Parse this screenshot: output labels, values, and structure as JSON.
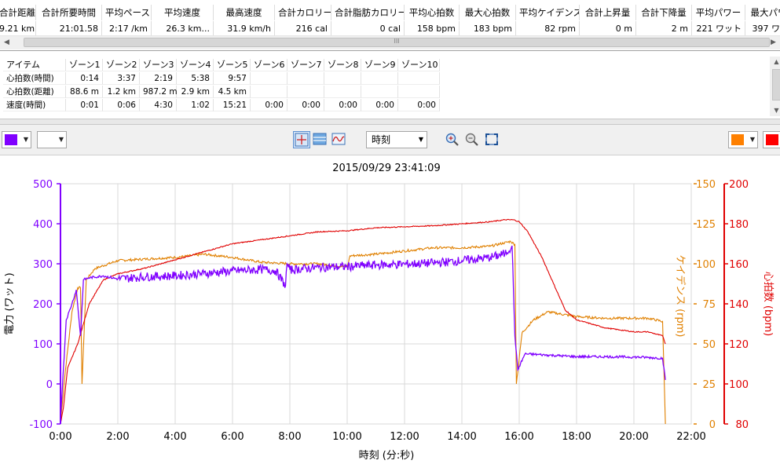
{
  "summary": {
    "headers": [
      "合計距離",
      "合計所要時間",
      "平均ペース",
      "平均速度",
      "最高速度",
      "合計カロリー",
      "合計脂肪カロリー",
      "平均心拍数",
      "最大心拍数",
      "平均ケイデンス",
      "合計上昇量",
      "合計下降量",
      "平均パワー",
      "最大パワ"
    ],
    "values": [
      "9.21 km",
      "21:01.58",
      "2:17 /km",
      "26.3 km...",
      "31.9 km/h",
      "216 cal",
      "0 cal",
      "158 bpm",
      "183 bpm",
      "82 rpm",
      "0 m",
      "2 m",
      "221 ワット",
      "397 ワッ"
    ],
    "scroll_grip": "III"
  },
  "zones": {
    "headers": [
      "アイテム",
      "ゾーン1",
      "ゾーン2",
      "ゾーン3",
      "ゾーン4",
      "ゾーン5",
      "ゾーン6",
      "ゾーン7",
      "ゾーン8",
      "ゾーン9",
      "ゾーン10"
    ],
    "rows": [
      [
        "心拍数(時間)",
        "0:14",
        "3:37",
        "2:19",
        "5:38",
        "9:57",
        "",
        "",
        "",
        "",
        ""
      ],
      [
        "心拍数(距離)",
        "88.6 m",
        "1.2 km",
        "987.2 m",
        "2.9 km",
        "4.5 km",
        "",
        "",
        "",
        "",
        ""
      ],
      [
        "速度(時間)",
        "0:01",
        "0:06",
        "4:30",
        "1:02",
        "15:21",
        "0:00",
        "0:00",
        "0:00",
        "0:00",
        "0:00"
      ]
    ]
  },
  "toolbar": {
    "left_color_1": "#8000ff",
    "left_color_2": "#ffffff",
    "right_color_1": "#ff8000",
    "right_color_2": "#ff0000",
    "axis_select": "時刻",
    "icons": [
      "crosshair-icon",
      "split-view-icon",
      "wave-icon",
      "zoom-in-icon",
      "zoom-out-icon",
      "fit-icon"
    ]
  },
  "chart_data": {
    "type": "line",
    "title": "2015/09/29 23:41:09",
    "xlabel": "時刻 (分:秒)",
    "x_ticks": [
      "0:00",
      "2:00",
      "4:00",
      "6:00",
      "8:00",
      "10:00",
      "12:00",
      "14:00",
      "16:00",
      "18:00",
      "20:00",
      "22:00"
    ],
    "xlim": [
      0,
      22
    ],
    "grid": true,
    "axes": [
      {
        "id": "power",
        "label": "電力 (ワット)",
        "side": "left",
        "color": "#8000ff",
        "ylim": [
          -100,
          500
        ],
        "ticks": [
          -100,
          0,
          100,
          200,
          300,
          400,
          500
        ]
      },
      {
        "id": "cadence",
        "label": "ケイデンス (rpm)",
        "side": "right",
        "color": "#e08000",
        "ylim": [
          0,
          150
        ],
        "ticks": [
          0,
          25,
          50,
          75,
          100,
          125,
          150
        ]
      },
      {
        "id": "hr",
        "label": "心拍数 (bpm)",
        "side": "right",
        "color": "#e00000",
        "ylim": [
          80,
          200
        ],
        "ticks": [
          80,
          100,
          120,
          140,
          160,
          180,
          200
        ]
      }
    ],
    "series": [
      {
        "axis": "power",
        "color": "#8000ff",
        "x": [
          0,
          0.2,
          0.4,
          0.55,
          0.7,
          0.8,
          1.0,
          1.5,
          2,
          3,
          4,
          5,
          6,
          7,
          7.5,
          7.85,
          7.9,
          8,
          9,
          10,
          11,
          12,
          13,
          14,
          15,
          15.5,
          15.75,
          15.85,
          15.95,
          16.2,
          17,
          18,
          19,
          20,
          20.5,
          21.0,
          21.1
        ],
        "y": [
          -90,
          160,
          200,
          235,
          120,
          260,
          265,
          270,
          262,
          268,
          270,
          276,
          282,
          286,
          283,
          245,
          300,
          285,
          291,
          293,
          297,
          299,
          302,
          308,
          316,
          325,
          345,
          120,
          35,
          75,
          72,
          68,
          68,
          67,
          66,
          64,
          10
        ]
      },
      {
        "axis": "cadence",
        "color": "#e08000",
        "x": [
          0,
          0.15,
          0.4,
          0.6,
          0.7,
          0.75,
          0.9,
          1.2,
          2,
          3,
          4,
          5,
          6,
          7,
          8,
          9,
          10,
          10.1,
          11,
          12,
          13,
          14,
          15,
          15.7,
          15.85,
          15.9,
          16.1,
          16.5,
          17,
          18,
          19,
          20,
          20.5,
          21.0,
          21.1
        ],
        "y": [
          0,
          30,
          70,
          85,
          85,
          25,
          90,
          97,
          102,
          103,
          104,
          106,
          104,
          101,
          100,
          100,
          98,
          105,
          106,
          108,
          110,
          110,
          111,
          114,
          112,
          25,
          57,
          65,
          70,
          67,
          66,
          66,
          66,
          64,
          0
        ]
      },
      {
        "axis": "hr",
        "color": "#e00000",
        "x": [
          0,
          0.1,
          0.25,
          0.6,
          0.8,
          1.0,
          1.5,
          2,
          3,
          4,
          5,
          6,
          7,
          8,
          9,
          10,
          11,
          12,
          13,
          14,
          15,
          15.5,
          15.8,
          16,
          16.3,
          16.8,
          17.2,
          17.6,
          18,
          18.5,
          19,
          19.5,
          20,
          20.5,
          21.0,
          21.1
        ],
        "y": [
          80,
          88,
          108,
          120,
          130,
          140,
          152,
          155,
          158,
          162,
          166,
          170,
          172,
          174,
          176,
          176.5,
          178,
          178.5,
          179,
          180,
          181,
          182,
          182,
          181,
          176,
          163,
          150,
          137,
          132,
          130,
          128,
          127,
          126,
          126,
          124,
          120
        ]
      }
    ]
  }
}
